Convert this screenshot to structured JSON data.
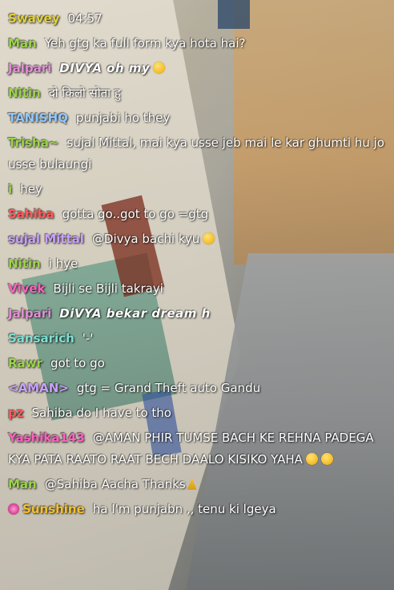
{
  "colors": {
    "name_yellow": "#e3d33b",
    "name_green": "#9bd54a",
    "name_pink": "#e28ed7",
    "name_blue": "#8fc7ff",
    "name_red": "#ff5c5c",
    "name_purple": "#c9a0ff",
    "name_gold": "#f6c12a",
    "name_cyan": "#7fe0d3",
    "name_magenta": "#ff62c2"
  },
  "messages": [
    {
      "user": "Swavey",
      "text": "04:57"
    },
    {
      "user": "Man",
      "text": "Yeh gtg ka full form kya hota hai?"
    },
    {
      "user": "Jalpari",
      "text": "DIVYA oh my"
    },
    {
      "user": "Nitin",
      "text": "दो किलो सोता हु"
    },
    {
      "user": "TANISHQ",
      "text": "punjabi ho they"
    },
    {
      "user": "Trisha~",
      "text": "sujal Mittal, mai kya usse jeb mai le kar ghumti hu jo usse bulaungi"
    },
    {
      "user": "i",
      "text": "hey"
    },
    {
      "user": "Sahiba",
      "text": "gotta go..got to go =gtg"
    },
    {
      "user": "sujal Mittal",
      "text": "@Divya bachi kyu"
    },
    {
      "user": "Nitin",
      "text": "i hye"
    },
    {
      "user": "Vivek",
      "text": "Bijli se Bijli takrayi"
    },
    {
      "user": "Jalpari",
      "text": "DiVYA bekar dream h"
    },
    {
      "user": "Sansarich",
      "text": "'-'"
    },
    {
      "user": "Rawr",
      "text": "got to go"
    },
    {
      "user": "<AMAN>",
      "text": "gtg = Grand Theft auto Gandu"
    },
    {
      "user": "pz",
      "text": "Sahiba do I have to tho"
    },
    {
      "user": "Yashika143",
      "text": "@AMAN PHIR TUMSE BACH KE REHNA PADEGA KYA PATA RAATO RAAT BECH DAALO KISIKO YAHA"
    },
    {
      "user": "Man",
      "text": "@Sahiba Aacha Thanks"
    },
    {
      "user": "Sunshine",
      "text": "ha I'm punjabn ,, tenu ki lgeya"
    }
  ],
  "icons": {
    "emoji": "smiley-emoji-icon",
    "thinking": "thinking-emoji-icon",
    "laugh": "laughing-emoji-icon",
    "hands": "praying-hands-icon",
    "badge": "user-badge-icon"
  }
}
